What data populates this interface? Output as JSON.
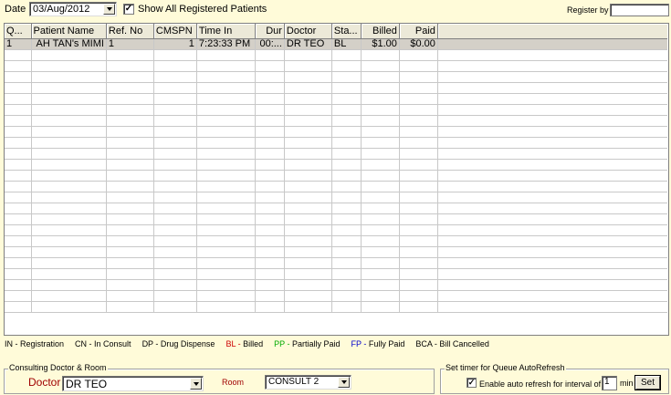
{
  "toolbar": {
    "date_label": "Date",
    "date_value": "03/Aug/2012",
    "show_all_label": "Show All Registered Patients",
    "show_all_checked": "✓",
    "register_by_label": "Register by",
    "register_by_value": ""
  },
  "grid": {
    "columns": [
      "Q...",
      "Patient Name",
      "Ref. No",
      "CMSPN",
      "Time In",
      "Dur",
      "Doctor",
      "Sta...",
      "Billed",
      "Paid"
    ],
    "rows": [
      [
        "1",
        "AH TAN's MIMI",
        "1",
        "1",
        "7:23:33 PM",
        "00:...",
        "DR TEO",
        "BL",
        "$1.00",
        "$0.00"
      ]
    ]
  },
  "legend": [
    {
      "code": "IN -",
      "text": "Registration",
      "color": "#000000"
    },
    {
      "code": "CN -",
      "text": "In Consult",
      "color": "#000000"
    },
    {
      "code": "DP -",
      "text": "Drug Dispense",
      "color": "#000000"
    },
    {
      "code": "BL -",
      "text": "Billed",
      "color": "#cc0000"
    },
    {
      "code": "PP -",
      "text": "Partially Paid",
      "color": "#00aa00"
    },
    {
      "code": "FP -",
      "text": "Fully Paid",
      "color": "#0000cc"
    },
    {
      "code": "BCA -",
      "text": "Bill Cancelled",
      "color": "#000000"
    }
  ],
  "consult": {
    "group_title": "Consulting Doctor & Room",
    "doctor_label": "Doctor",
    "doctor_value": "DR TEO",
    "room_label": "Room",
    "room_value": "CONSULT 2",
    "label_color": "#a00000"
  },
  "refresh": {
    "group_title": "Set timer for Queue AutoRefresh",
    "enable_label": "Enable auto refresh for interval of",
    "enable_checked": "✓",
    "interval_value": "1",
    "unit_label": "min",
    "set_label": "Set"
  }
}
